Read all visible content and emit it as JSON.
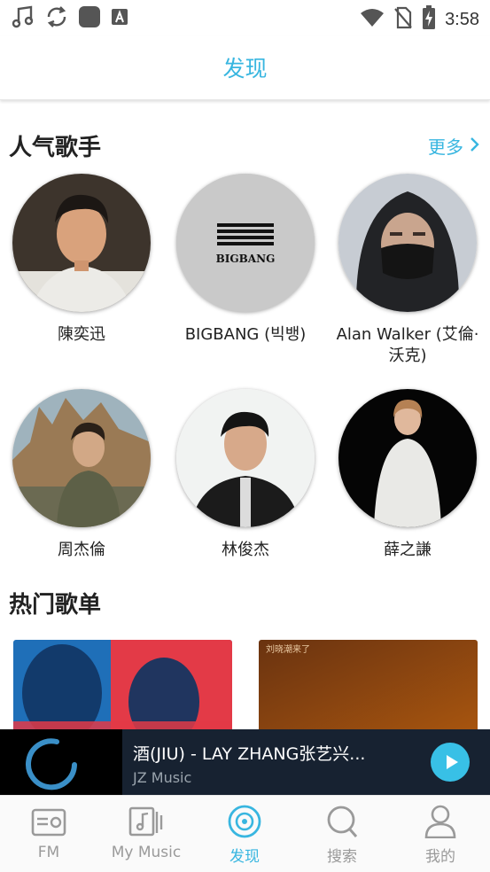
{
  "status_bar": {
    "time": "3:58",
    "left_icons": [
      "music-note-icon",
      "sync-icon",
      "app-square-icon",
      "text-a-icon"
    ],
    "right_icons": [
      "wifi-icon",
      "no-sim-icon",
      "battery-charging-icon"
    ]
  },
  "header": {
    "title": "发现"
  },
  "artists_section": {
    "title": "人气歌手",
    "more_label": "更多",
    "artists": [
      {
        "name": "陳奕迅"
      },
      {
        "name": "BIGBANG (빅뱅)",
        "logo_text": "BIGBANG"
      },
      {
        "name": "Alan Walker (艾倫·沃克)"
      },
      {
        "name": "周杰倫"
      },
      {
        "name": "林俊杰"
      },
      {
        "name": "薛之謙"
      }
    ]
  },
  "playlists_section": {
    "title": "热门歌单",
    "playlists": [
      {
        "cover_text": ""
      },
      {
        "cover_text": "刘晓潮来了"
      }
    ]
  },
  "player": {
    "title": "酒(JIU) - LAY ZHANG张艺兴...",
    "artist": "JZ Music",
    "loading": true
  },
  "tabs": [
    {
      "label": "FM",
      "icon": "radio-icon",
      "active": false
    },
    {
      "label": "My Music",
      "icon": "music-library-icon",
      "active": false
    },
    {
      "label": "发现",
      "icon": "disc-icon",
      "active": true
    },
    {
      "label": "搜索",
      "icon": "search-icon",
      "active": false
    },
    {
      "label": "我的",
      "icon": "user-icon",
      "active": false
    }
  ],
  "colors": {
    "accent": "#38b6e0",
    "player_bg": "#172231",
    "tab_inactive": "#9a9a9a"
  }
}
